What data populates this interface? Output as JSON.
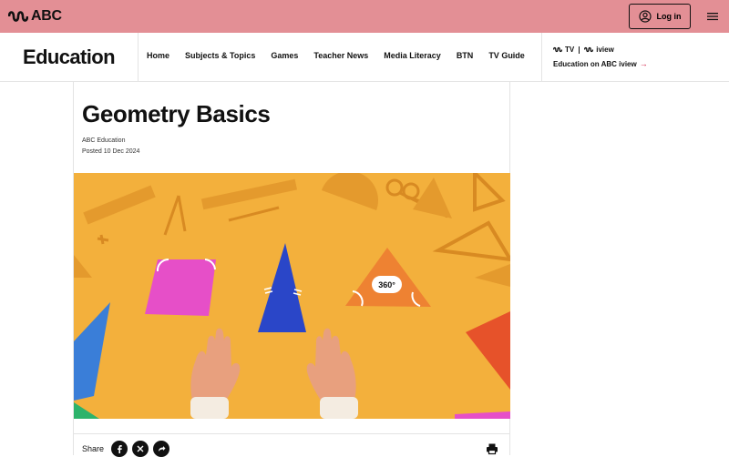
{
  "brand": {
    "name": "ABC",
    "icon": "abc-wave-logo-icon"
  },
  "topbar": {
    "login_label": "Log in",
    "background": "#e38f95"
  },
  "section": {
    "title": "Education"
  },
  "nav": {
    "items": [
      {
        "label": "Home"
      },
      {
        "label": "Subjects & Topics"
      },
      {
        "label": "Games"
      },
      {
        "label": "Teacher News"
      },
      {
        "label": "Media Literacy"
      },
      {
        "label": "BTN"
      },
      {
        "label": "TV Guide"
      }
    ]
  },
  "iview": {
    "logo_tv": "TV",
    "logo_iview": "iview",
    "link_label": "Education on ABC iview"
  },
  "article": {
    "headline": "Geometry Basics",
    "byline": "ABC Education",
    "posted": "Posted 10 Dec 2024",
    "hero": {
      "background": "#f3b03c",
      "triangle_label": "360°"
    },
    "share_label": "Share"
  },
  "colors": {
    "accent": "#d0163e",
    "hero_bg": "#f3b03c",
    "pink": "#e64fc8",
    "blue": "#2a46c8",
    "orange": "#ee8232"
  }
}
